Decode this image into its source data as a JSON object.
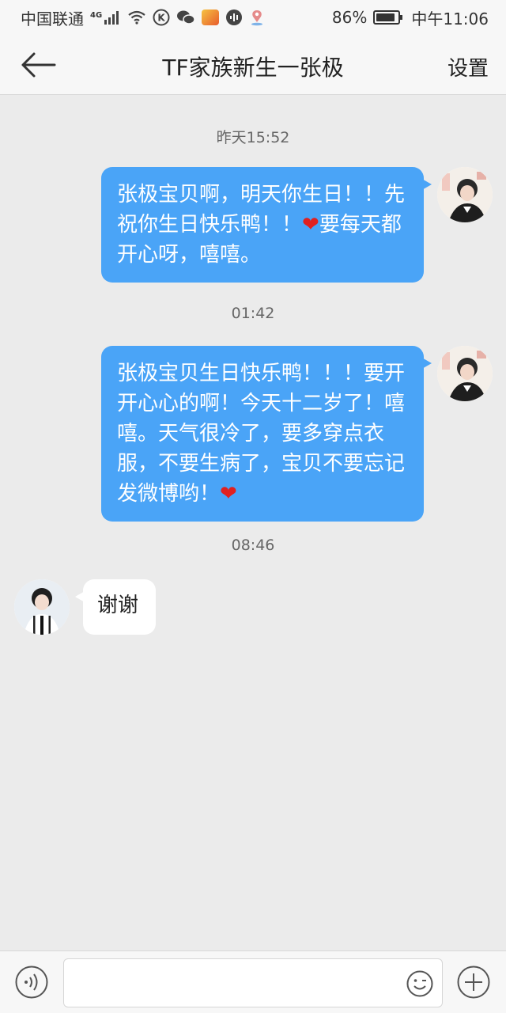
{
  "status_bar": {
    "carrier": "中国联通",
    "network": "4G",
    "battery": "86%",
    "battery_level": 0.86,
    "time": "中午11:06",
    "icons": [
      "signal-icon",
      "wifi-icon",
      "k-app-icon",
      "wechat-icon",
      "app-badge-icon",
      "audio-app-icon",
      "location-icon",
      "battery-icon"
    ]
  },
  "header": {
    "title": "TF家族新生一张极",
    "settings_label": "设置",
    "back_icon": "back-arrow-icon"
  },
  "messages": [
    {
      "type": "timestamp",
      "text": "昨天15:52"
    },
    {
      "type": "outgoing",
      "parts": [
        "张极宝贝啊，明天你生日！！先祝你生日快乐鸭！！",
        "❤",
        "要每天都开心呀，嘻嘻。"
      ]
    },
    {
      "type": "timestamp",
      "text": "01:42"
    },
    {
      "type": "outgoing",
      "parts": [
        "张极宝贝生日快乐鸭！！！要开开心心的啊！今天十二岁了！嘻嘻。天气很冷了，要多穿点衣服，不要生病了，宝贝不要忘记发微博哟！",
        "❤"
      ]
    },
    {
      "type": "timestamp",
      "text": "08:46"
    },
    {
      "type": "incoming",
      "text": "谢谢"
    }
  ],
  "input_bar": {
    "value": "",
    "placeholder": "",
    "icons": [
      "voice-icon",
      "emoji-icon",
      "plus-icon"
    ]
  },
  "colors": {
    "bubble_out": "#4aa4f7",
    "bubble_in": "#ffffff",
    "background": "#ebebeb",
    "heart": "#e02020"
  }
}
